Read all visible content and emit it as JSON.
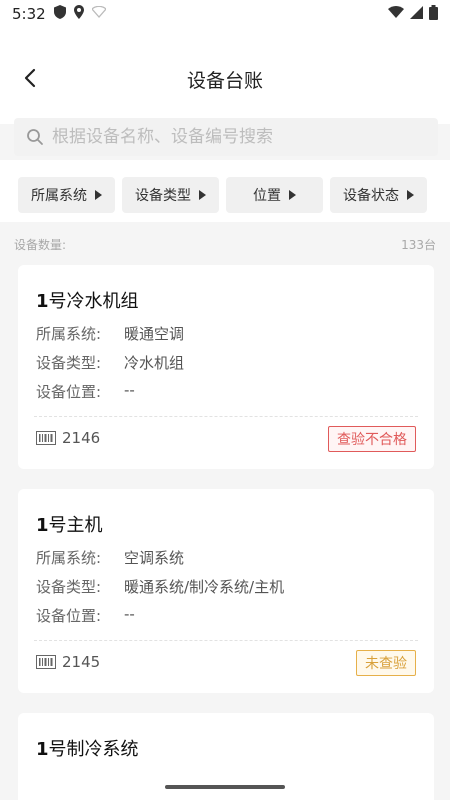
{
  "status_bar": {
    "time": "5:32"
  },
  "header": {
    "title": "设备台账"
  },
  "search": {
    "placeholder": "根据设备名称、设备编号搜索"
  },
  "filters": [
    "所属系统",
    "设备类型",
    "位置",
    "设备状态"
  ],
  "summary": {
    "label": "设备数量:",
    "value": "133台"
  },
  "cards": [
    {
      "title_num": "1",
      "title_text": "号冷水机组",
      "system_label": "所属系统:",
      "system_value": "暖通空调",
      "type_label": "设备类型:",
      "type_value": "冷水机组",
      "location_label": "设备位置:",
      "location_value": "--",
      "code": "2146",
      "status": "查验不合格"
    },
    {
      "title_num": "1",
      "title_text": "号主机",
      "system_label": "所属系统:",
      "system_value": "空调系统",
      "type_label": "设备类型:",
      "type_value": "暖通系统/制冷系统/主机",
      "location_label": "设备位置:",
      "location_value": "--",
      "code": "2145",
      "status": "未查验"
    },
    {
      "title_num": "1",
      "title_text": "号制冷系统"
    }
  ],
  "colors": {
    "fail": "#e05a5a",
    "pending": "#d8a03a"
  }
}
